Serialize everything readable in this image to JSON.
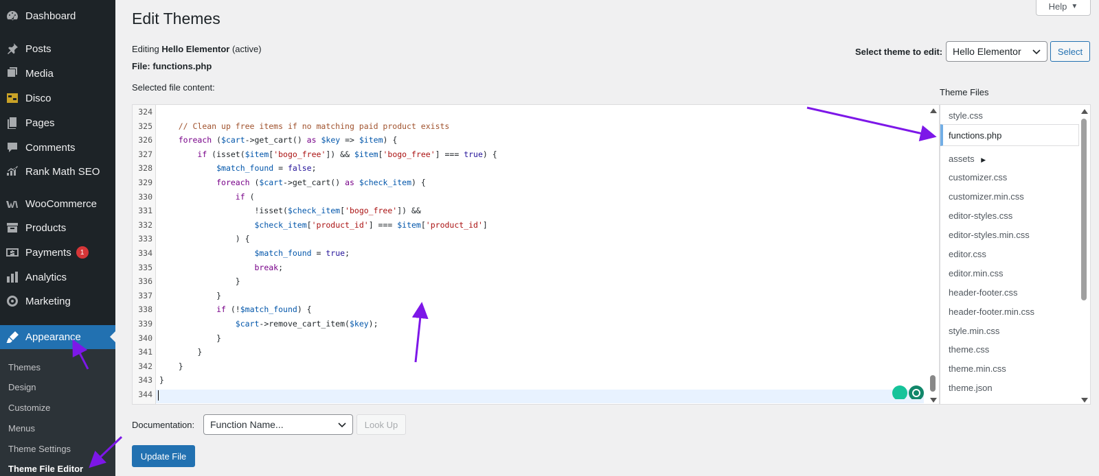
{
  "sidebar": {
    "items": [
      {
        "label": "Dashboard",
        "icon": "dashboard-icon"
      },
      {
        "label": "Posts",
        "icon": "pin-icon"
      },
      {
        "label": "Media",
        "icon": "media-icon"
      },
      {
        "label": "Disco",
        "icon": "disco-icon"
      },
      {
        "label": "Pages",
        "icon": "pages-icon"
      },
      {
        "label": "Comments",
        "icon": "comment-icon"
      },
      {
        "label": "Rank Math SEO",
        "icon": "chart-icon"
      },
      {
        "label": "WooCommerce",
        "icon": "woo-icon"
      },
      {
        "label": "Products",
        "icon": "archive-icon"
      },
      {
        "label": "Payments",
        "icon": "payments-icon",
        "badge": "1"
      },
      {
        "label": "Analytics",
        "icon": "bar-chart-icon"
      },
      {
        "label": "Marketing",
        "icon": "megaphone-icon"
      },
      {
        "label": "Appearance",
        "icon": "brush-icon"
      }
    ],
    "submenu": [
      "Themes",
      "Design",
      "Customize",
      "Menus",
      "Theme Settings",
      "Theme File Editor"
    ],
    "active_color": "#2271b1"
  },
  "header": {
    "title": "Edit Themes",
    "help_label": "Help"
  },
  "editing": {
    "prefix": "Editing",
    "theme_name": "Hello Elementor",
    "status": "(active)",
    "file_line": "File: functions.php",
    "selected_label": "Selected file content:"
  },
  "theme_select": {
    "label": "Select theme to edit:",
    "value": "Hello Elementor",
    "button": "Select"
  },
  "code": {
    "line_numbers": [
      "324",
      "325",
      "326",
      "327",
      "328",
      "329",
      "330",
      "331",
      "332",
      "333",
      "334",
      "335",
      "336",
      "337",
      "338",
      "339",
      "340",
      "341",
      "342",
      "343",
      "344"
    ],
    "lines": [
      [],
      [
        {
          "t": "    "
        },
        {
          "t": "// Clean up free items if no matching paid product exists",
          "c": "cm"
        }
      ],
      [
        {
          "t": "    "
        },
        {
          "t": "foreach",
          "c": "kw"
        },
        {
          "t": " ("
        },
        {
          "t": "$cart",
          "c": "var"
        },
        {
          "t": "->get_cart() "
        },
        {
          "t": "as",
          "c": "kw"
        },
        {
          "t": " "
        },
        {
          "t": "$key",
          "c": "var"
        },
        {
          "t": " => "
        },
        {
          "t": "$item",
          "c": "var"
        },
        {
          "t": ") {"
        }
      ],
      [
        {
          "t": "        "
        },
        {
          "t": "if",
          "c": "kw"
        },
        {
          "t": " (isset("
        },
        {
          "t": "$item",
          "c": "var"
        },
        {
          "t": "["
        },
        {
          "t": "'bogo_free'",
          "c": "str"
        },
        {
          "t": "]) && "
        },
        {
          "t": "$item",
          "c": "var"
        },
        {
          "t": "["
        },
        {
          "t": "'bogo_free'",
          "c": "str"
        },
        {
          "t": "] === "
        },
        {
          "t": "true",
          "c": "atom"
        },
        {
          "t": ") {"
        }
      ],
      [
        {
          "t": "            "
        },
        {
          "t": "$match_found",
          "c": "var"
        },
        {
          "t": " = "
        },
        {
          "t": "false",
          "c": "atom"
        },
        {
          "t": ";"
        }
      ],
      [
        {
          "t": "            "
        },
        {
          "t": "foreach",
          "c": "kw"
        },
        {
          "t": " ("
        },
        {
          "t": "$cart",
          "c": "var"
        },
        {
          "t": "->get_cart() "
        },
        {
          "t": "as",
          "c": "kw"
        },
        {
          "t": " "
        },
        {
          "t": "$check_item",
          "c": "var"
        },
        {
          "t": ") {"
        }
      ],
      [
        {
          "t": "                "
        },
        {
          "t": "if",
          "c": "kw"
        },
        {
          "t": " ("
        }
      ],
      [
        {
          "t": "                    !isset("
        },
        {
          "t": "$check_item",
          "c": "var"
        },
        {
          "t": "["
        },
        {
          "t": "'bogo_free'",
          "c": "str"
        },
        {
          "t": "]) &&"
        }
      ],
      [
        {
          "t": "                    "
        },
        {
          "t": "$check_item",
          "c": "var"
        },
        {
          "t": "["
        },
        {
          "t": "'product_id'",
          "c": "str"
        },
        {
          "t": "] === "
        },
        {
          "t": "$item",
          "c": "var"
        },
        {
          "t": "["
        },
        {
          "t": "'product_id'",
          "c": "str"
        },
        {
          "t": "]"
        }
      ],
      [
        {
          "t": "                ) {"
        }
      ],
      [
        {
          "t": "                    "
        },
        {
          "t": "$match_found",
          "c": "var"
        },
        {
          "t": " = "
        },
        {
          "t": "true",
          "c": "atom"
        },
        {
          "t": ";"
        }
      ],
      [
        {
          "t": "                    "
        },
        {
          "t": "break",
          "c": "kw"
        },
        {
          "t": ";"
        }
      ],
      [
        {
          "t": "                }"
        }
      ],
      [
        {
          "t": "            }"
        }
      ],
      [
        {
          "t": "            "
        },
        {
          "t": "if",
          "c": "kw"
        },
        {
          "t": " (!"
        },
        {
          "t": "$match_found",
          "c": "var"
        },
        {
          "t": ") {"
        }
      ],
      [
        {
          "t": "                "
        },
        {
          "t": "$cart",
          "c": "var"
        },
        {
          "t": "->remove_cart_item("
        },
        {
          "t": "$key",
          "c": "var"
        },
        {
          "t": ");"
        }
      ],
      [
        {
          "t": "            }"
        }
      ],
      [
        {
          "t": "        }"
        }
      ],
      [
        {
          "t": "    }"
        }
      ],
      [
        {
          "t": "}"
        }
      ],
      []
    ]
  },
  "theme_files": {
    "title": "Theme Files",
    "items": [
      "style.css",
      "functions.php",
      "assets",
      "customizer.css",
      "customizer.min.css",
      "editor-styles.css",
      "editor-styles.min.css",
      "editor.css",
      "editor.min.css",
      "header-footer.css",
      "header-footer.min.css",
      "style.min.css",
      "theme.css",
      "theme.min.css",
      "theme.json"
    ],
    "current": "functions.php"
  },
  "documentation": {
    "label": "Documentation:",
    "placeholder_value": "Function Name...",
    "lookup_label": "Look Up"
  },
  "update_button": "Update File",
  "annotation_color": "#7d17e8"
}
